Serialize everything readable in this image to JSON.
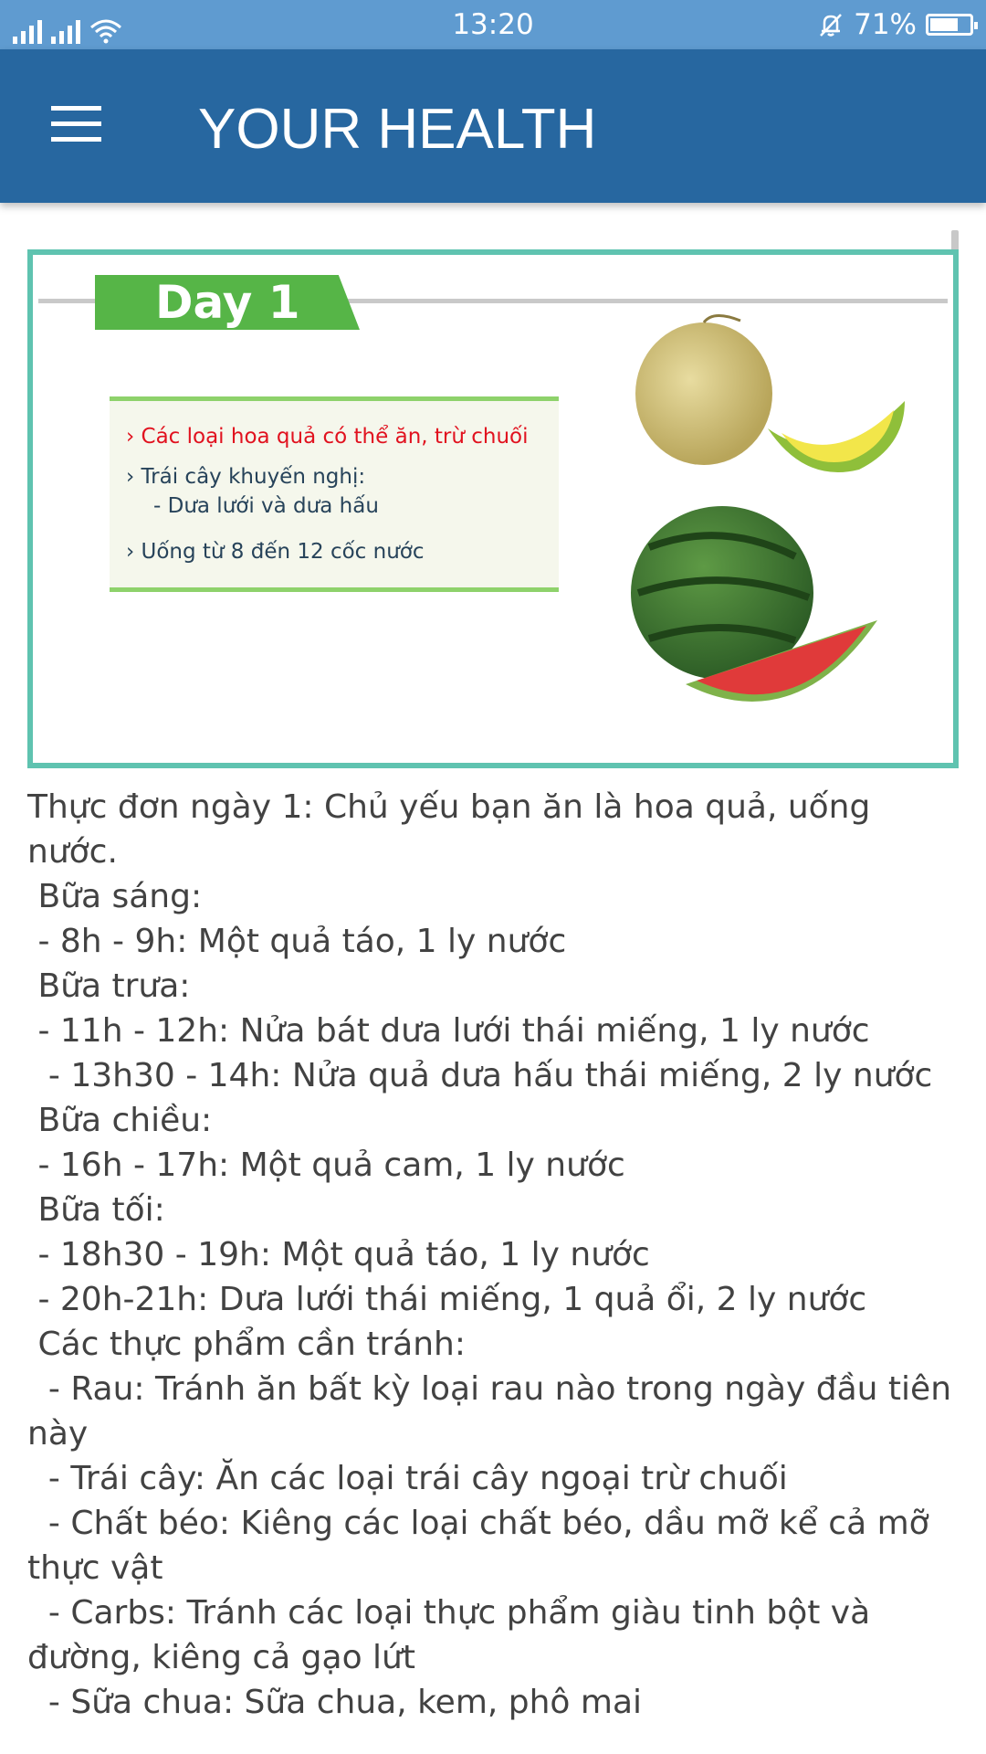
{
  "status_bar": {
    "time": "13:20",
    "battery_percent": "71%",
    "battery_level": 0.71,
    "icons": [
      "signal-icon",
      "signal-icon",
      "wifi-icon",
      "bell-off-icon",
      "battery-icon"
    ]
  },
  "app_bar": {
    "title": "YOUR HEALTH",
    "menu_icon": "hamburger-menu-icon"
  },
  "banner": {
    "day_label": "Day 1",
    "lines": [
      "› Các loại hoa quả có thể ăn, trừ chuối",
      "› Trái cây khuyến nghị:",
      "- Dưa lưới và dưa hấu",
      "› Uống từ 8 đến 12 cốc nước"
    ]
  },
  "article": {
    "text": "Thực đơn ngày 1: Chủ yếu bạn ăn là hoa quả, uống\nnước.\n Bữa sáng:\n - 8h - 9h: Một quả táo, 1 ly nước\n Bữa trưa:\n - 11h - 12h: Nửa bát dưa lưới thái miếng, 1 ly nước\n  - 13h30 - 14h: Nửa quả dưa hấu thái miếng, 2 ly nước\n Bữa chiều:\n - 16h - 17h: Một quả cam, 1 ly nước\n Bữa tối:\n - 18h30 - 19h: Một quả táo, 1 ly nước\n - 20h-21h: Dưa lưới thái miếng, 1 quả ổi, 2 ly nước\n Các thực phẩm cần tránh:\n  - Rau: Tránh ăn bất kỳ loại rau nào trong ngày đầu tiên\nnày\n  - Trái cây: Ăn các loại trái cây ngoại trừ chuối\n  - Chất béo: Kiêng các loại chất béo, dầu mỡ kể cả mỡ\nthực vật\n  - Carbs: Tránh các loại thực phẩm giàu tinh bột và\nđường, kiêng cả gạo lứt\n  - Sữa chua: Sữa chua, kem, phô mai"
  },
  "colors": {
    "status_bar": "#5f9bd0",
    "app_bar": "#2767a0",
    "banner_border": "#5fc3b0",
    "day_tag": "#56b547",
    "highlight_red": "#e1121f",
    "body_text": "#424242"
  }
}
